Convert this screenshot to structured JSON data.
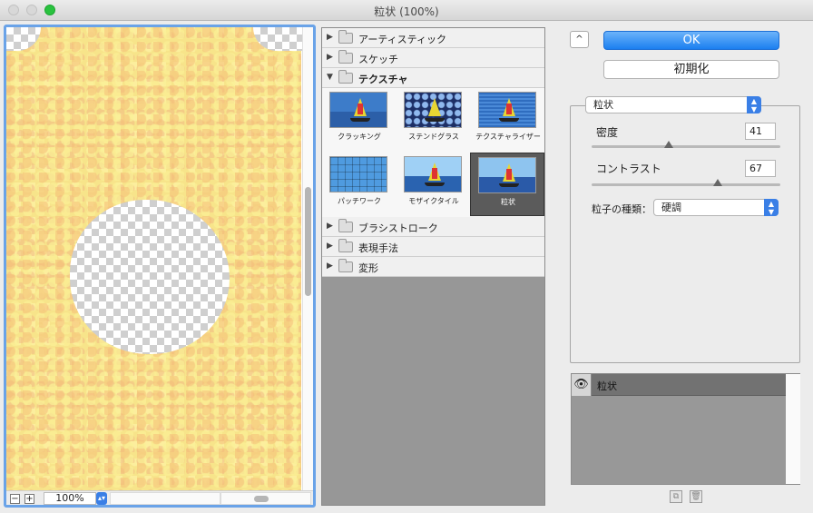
{
  "window": {
    "title": "粒状 (100%)"
  },
  "preview": {
    "zoom": "100%",
    "zoom_out_label": "−",
    "zoom_in_label": "+"
  },
  "gallery": {
    "categories_top": [
      {
        "label": "アーティスティック",
        "expanded": false
      },
      {
        "label": "スケッチ",
        "expanded": false
      },
      {
        "label": "テクスチャ",
        "expanded": true
      }
    ],
    "thumbnails": [
      {
        "label": "クラッキング",
        "selected": false
      },
      {
        "label": "ステンドグラス",
        "selected": false
      },
      {
        "label": "テクスチャライザー",
        "selected": false
      },
      {
        "label": "パッチワーク",
        "selected": false
      },
      {
        "label": "モザイクタイル",
        "selected": false
      },
      {
        "label": "粒状",
        "selected": true
      }
    ],
    "categories_bottom": [
      {
        "label": "ブラシストローク",
        "expanded": false
      },
      {
        "label": "表現手法",
        "expanded": false
      },
      {
        "label": "変形",
        "expanded": false
      }
    ]
  },
  "buttons": {
    "ok": "OK",
    "reset": "初期化",
    "collapse": "^"
  },
  "settings": {
    "filter": "粒状",
    "density_label": "密度",
    "density_value": "41",
    "density_fraction": 0.41,
    "contrast_label": "コントラスト",
    "contrast_value": "67",
    "contrast_fraction": 0.67,
    "grain_type_label": "粒子の種類：",
    "grain_type_value": "硬調"
  },
  "layers": [
    {
      "name": "粒状",
      "visible": true
    }
  ],
  "colors": {
    "accent": "#1b7ff0",
    "selection_border": "#6aa3e8"
  }
}
